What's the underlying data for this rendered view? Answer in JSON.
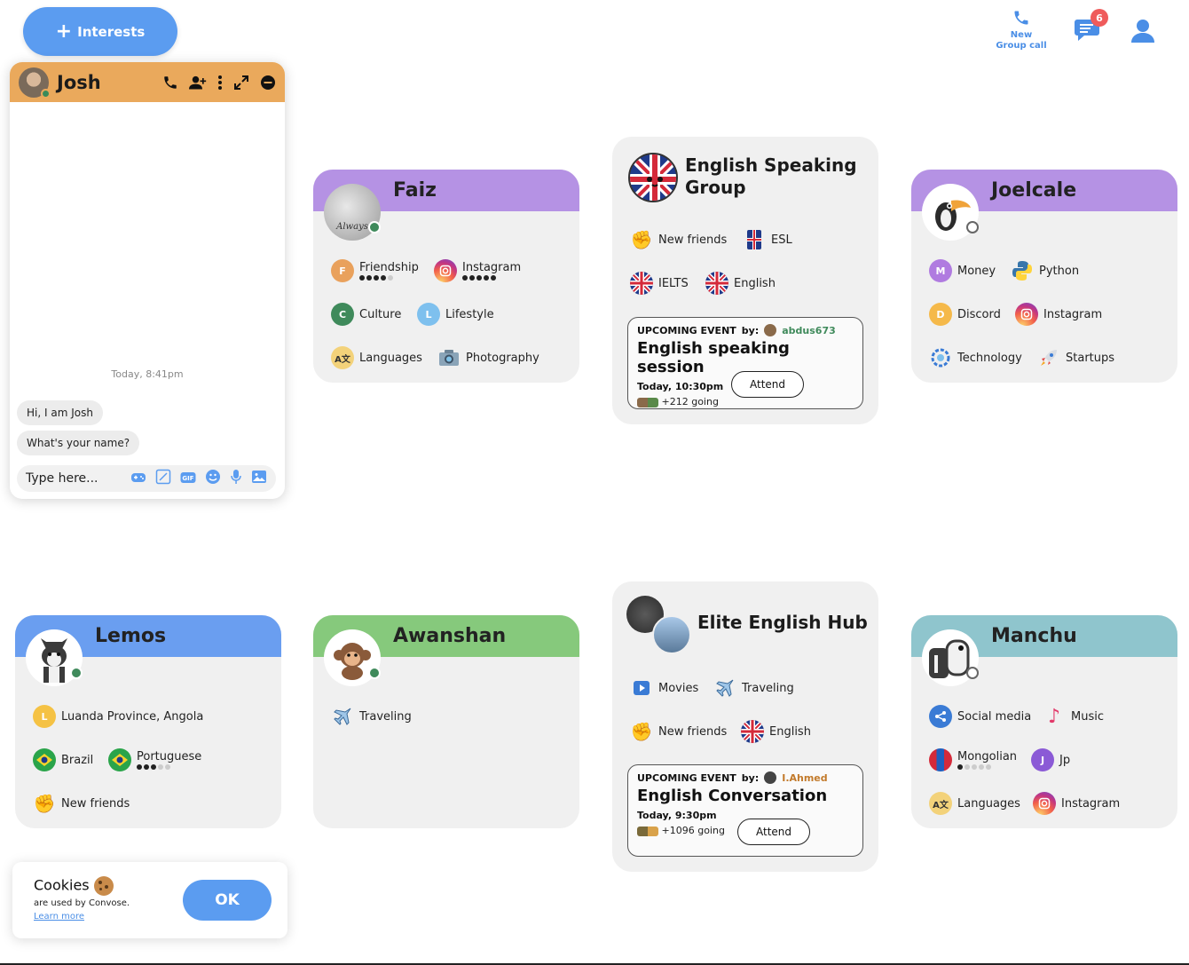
{
  "header": {
    "interests_label": "Interests",
    "new_call_label_1": "New",
    "new_call_label_2": "Group call",
    "chats_badge": "6"
  },
  "chat": {
    "name": "Josh",
    "time": "Today, 8:41pm",
    "messages": [
      "Hi, I am Josh",
      "What's your name?"
    ],
    "input_placeholder": "Type here..."
  },
  "cards": {
    "faiz": {
      "name": "Faiz",
      "chips": [
        "Friendship",
        "Instagram",
        "Culture",
        "Lifestyle",
        "Languages",
        "Photography"
      ],
      "friendship_level": 4,
      "instagram_level": 5
    },
    "english_group": {
      "name_1": "English Speaking",
      "name_2": "Group",
      "chips": [
        "New friends",
        "ESL",
        "IELTS",
        "English"
      ],
      "event": {
        "label": "UPCOMING EVENT",
        "by_label": "by:",
        "by_user": "abdus673",
        "title": "English speaking session",
        "time": "Today, 10:30pm",
        "going": "+212 going",
        "attend": "Attend"
      }
    },
    "joelcale": {
      "name": "Joelcale",
      "chips": [
        "Money",
        "Python",
        "Discord",
        "Instagram",
        "Technology",
        "Startups"
      ]
    },
    "lemos": {
      "name": "Lemos",
      "chips": [
        "Luanda Province, Angola",
        "Brazil",
        "Portuguese",
        "New friends"
      ],
      "portuguese_level": 3
    },
    "awanshan": {
      "name": "Awanshan",
      "chips": [
        "Traveling"
      ]
    },
    "elite": {
      "name": "Elite English Hub",
      "chips": [
        "Movies",
        "Traveling",
        "New friends",
        "English"
      ],
      "event": {
        "label": "UPCOMING EVENT",
        "by_label": "by:",
        "by_user": "I.Ahmed",
        "title": "English Conversation",
        "time": "Today, 9:30pm",
        "going": "+1096 going",
        "attend": "Attend"
      }
    },
    "manchu": {
      "name": "Manchu",
      "chips": [
        "Social media",
        "Music",
        "Mongolian",
        "Jp",
        "Languages",
        "Instagram"
      ],
      "mongolian_level": 1
    }
  },
  "cookies": {
    "title": "Cookies",
    "subtitle": "are used by Convose.",
    "link": "Learn more",
    "ok": "OK"
  },
  "colors": {
    "accent": "#5b9cf0",
    "purple_band": "#b592e4",
    "blue_band": "#6a9ef0",
    "green_band": "#86c97c",
    "teal_band": "#8fc5cd",
    "chat_header": "#eaa95c"
  }
}
